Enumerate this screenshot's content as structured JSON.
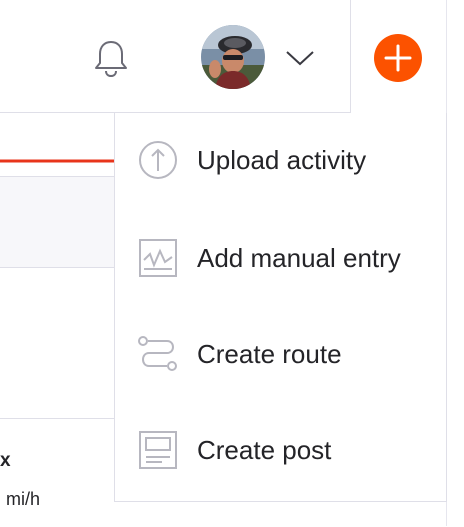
{
  "colors": {
    "accent": "#fc5200",
    "arrow": "#e8351b",
    "icon_gray": "#b7b7c0",
    "border": "#dfdfe8"
  },
  "header": {
    "notifications_icon": "bell-icon",
    "profile_menu_icon": "chevron-down-icon",
    "create_button_icon": "plus-icon"
  },
  "create_menu": {
    "items": [
      {
        "label": "Upload activity",
        "icon": "upload-icon"
      },
      {
        "label": "Add manual entry",
        "icon": "manual-entry-icon"
      },
      {
        "label": "Create route",
        "icon": "route-icon"
      },
      {
        "label": "Create post",
        "icon": "post-icon"
      }
    ]
  },
  "background": {
    "stat_label": "x",
    "stat_value": "mi/h"
  }
}
